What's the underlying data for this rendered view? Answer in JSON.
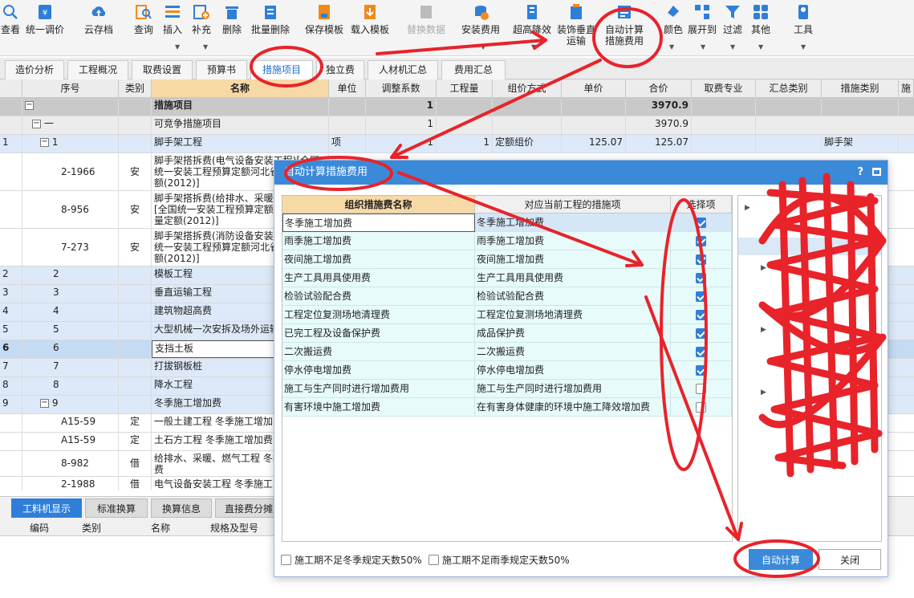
{
  "toolbar": {
    "items": [
      {
        "label": "查看",
        "icon": "view-icon"
      },
      {
        "label": "统一调价",
        "icon": "price-adjust-icon"
      },
      {
        "label": "云存档",
        "icon": "cloud-upload-icon"
      },
      {
        "label": "查询",
        "icon": "query-icon"
      },
      {
        "label": "插入",
        "icon": "insert-icon"
      },
      {
        "label": "补充",
        "icon": "supplement-icon"
      },
      {
        "label": "删除",
        "icon": "trash-icon"
      },
      {
        "label": "批量删除",
        "icon": "batch-delete-icon"
      },
      {
        "label": "保存模板",
        "icon": "save-template-icon"
      },
      {
        "label": "载入模板",
        "icon": "load-template-icon"
      },
      {
        "label": "替换数据",
        "icon": "replace-data-icon"
      },
      {
        "label": "安装费用",
        "icon": "install-fee-icon"
      },
      {
        "label": "超高降效",
        "icon": "height-reduce-icon"
      },
      {
        "label": "装饰垂直",
        "label2": "运输",
        "icon": "vertical-transport-icon"
      },
      {
        "label": "自动计算",
        "label2": "措施费用",
        "icon": "auto-calc-icon"
      },
      {
        "label": "颜色",
        "icon": "color-icon"
      },
      {
        "label": "展开到",
        "icon": "expand-icon"
      },
      {
        "label": "过滤",
        "icon": "filter-icon"
      },
      {
        "label": "其他",
        "icon": "other-icon"
      },
      {
        "label": "工具",
        "icon": "tool-icon"
      }
    ]
  },
  "tabs": [
    "造价分析",
    "工程概况",
    "取费设置",
    "预算书",
    "措施项目",
    "独立费",
    "人材机汇总",
    "费用汇总"
  ],
  "active_tab": "措施项目",
  "grid": {
    "headers": [
      "序号",
      "类别",
      "名称",
      "单位",
      "调整系数",
      "工程量",
      "组价方式",
      "单价",
      "合价",
      "取费专业",
      "汇总类别",
      "措施类别",
      "施"
    ],
    "rows": [
      {
        "idx": "",
        "seq": "措施项目",
        "cat": "",
        "name": "措施项目",
        "unit": "",
        "coef": "1",
        "qty": "",
        "method": "",
        "price": "",
        "total": "3970.9",
        "measure": ""
      },
      {
        "idx": "",
        "seq": "一",
        "cat": "",
        "name": "可竞争措施项目",
        "unit": "",
        "coef": "1",
        "qty": "",
        "method": "",
        "price": "",
        "total": "3970.9",
        "measure": ""
      },
      {
        "idx": "1",
        "seq": "1",
        "cat": "",
        "name": "脚手架工程",
        "unit": "项",
        "coef": "1",
        "qty": "1",
        "method": "定额组价",
        "price": "125.07",
        "total": "125.07",
        "measure": "脚手架"
      },
      {
        "idx": "",
        "seq": "2-1966",
        "cat": "安",
        "name": "脚手架搭拆费(电气设备安装工程)[全国统一安装工程预算定额河北省消耗量定额(2012)]",
        "unit": "",
        "coef": "",
        "qty": "",
        "method": "",
        "price": "",
        "total": "",
        "measure": ""
      },
      {
        "idx": "",
        "seq": "8-956",
        "cat": "安",
        "name": "脚手架搭拆费(给排水、采暖、燃气工程)[全国统一安装工程预算定额河北省消耗量定额(2012)]",
        "unit": "",
        "coef": "",
        "qty": "",
        "method": "",
        "price": "",
        "total": "",
        "measure": ""
      },
      {
        "idx": "",
        "seq": "7-273",
        "cat": "安",
        "name": "脚手架搭拆费(消防设备安装工程)[全国统一安装工程预算定额河北省消耗量定额(2012)]",
        "unit": "",
        "coef": "",
        "qty": "",
        "method": "",
        "price": "",
        "total": "",
        "measure": ""
      },
      {
        "idx": "2",
        "seq": "2",
        "cat": "",
        "name": "模板工程",
        "unit": "",
        "coef": "",
        "qty": "",
        "method": "",
        "price": "",
        "total": "",
        "measure": ""
      },
      {
        "idx": "3",
        "seq": "3",
        "cat": "",
        "name": "垂直运输工程",
        "unit": "",
        "coef": "",
        "qty": "",
        "method": "",
        "price": "",
        "total": "",
        "measure": ""
      },
      {
        "idx": "4",
        "seq": "4",
        "cat": "",
        "name": "建筑物超高费",
        "unit": "",
        "coef": "",
        "qty": "",
        "method": "",
        "price": "",
        "total": "",
        "measure": ""
      },
      {
        "idx": "5",
        "seq": "5",
        "cat": "",
        "name": "大型机械一次安拆及场外运输",
        "unit": "",
        "coef": "",
        "qty": "",
        "method": "",
        "price": "",
        "total": "",
        "measure": ""
      },
      {
        "idx": "6",
        "seq": "6",
        "cat": "",
        "name": "支挡土板",
        "unit": "",
        "coef": "",
        "qty": "",
        "method": "",
        "price": "",
        "total": "",
        "measure": ""
      },
      {
        "idx": "7",
        "seq": "7",
        "cat": "",
        "name": "打拔钢板桩",
        "unit": "",
        "coef": "",
        "qty": "",
        "method": "",
        "price": "",
        "total": "",
        "measure": ""
      },
      {
        "idx": "8",
        "seq": "8",
        "cat": "",
        "name": "降水工程",
        "unit": "",
        "coef": "",
        "qty": "",
        "method": "",
        "price": "",
        "total": "",
        "measure": ""
      },
      {
        "idx": "9",
        "seq": "9",
        "cat": "",
        "name": "冬季施工增加费",
        "unit": "",
        "coef": "",
        "qty": "",
        "method": "",
        "price": "",
        "total": "",
        "measure": ""
      },
      {
        "idx": "",
        "seq": "A15-59",
        "cat": "定",
        "name": "一般土建工程 冬季施工增加",
        "unit": "",
        "coef": "",
        "qty": "",
        "method": "",
        "price": "",
        "total": "",
        "measure": ""
      },
      {
        "idx": "",
        "seq": "A15-59",
        "cat": "定",
        "name": "土石方工程 冬季施工增加费",
        "unit": "",
        "coef": "",
        "qty": "",
        "method": "",
        "price": "",
        "total": "",
        "measure": ""
      },
      {
        "idx": "",
        "seq": "8-982",
        "cat": "借",
        "name": "给排水、采暖、燃气工程 冬季施工增加费",
        "unit": "",
        "coef": "",
        "qty": "",
        "method": "",
        "price": "",
        "total": "",
        "measure": ""
      },
      {
        "idx": "",
        "seq": "2-1988",
        "cat": "借",
        "name": "电气设备安装工程 冬季施工",
        "unit": "",
        "coef": "",
        "qty": "",
        "method": "",
        "price": "",
        "total": "",
        "measure": ""
      }
    ]
  },
  "bottom": {
    "tabs": [
      "工料机显示",
      "标准换算",
      "换算信息",
      "直接费分摊"
    ],
    "headers": [
      "编码",
      "类别",
      "名称",
      "规格及型号"
    ]
  },
  "dialog": {
    "title": "自动计算措施费用",
    "help": "?",
    "headers": [
      "组织措施费名称",
      "对应当前工程的措施项",
      "选择项"
    ],
    "rows": [
      {
        "name": "冬季施工增加费",
        "match": "冬季施工增加费",
        "checked": true
      },
      {
        "name": "雨季施工增加费",
        "match": "雨季施工增加费",
        "checked": true
      },
      {
        "name": "夜间施工增加费",
        "match": "夜间施工增加费",
        "checked": true
      },
      {
        "name": "生产工具用具使用费",
        "match": "生产工具用具使用费",
        "checked": true
      },
      {
        "name": "检验试验配合费",
        "match": "检验试验配合费",
        "checked": true
      },
      {
        "name": "工程定位复测场地清理费",
        "match": "工程定位复测场地清理费",
        "checked": true
      },
      {
        "name": "已完工程及设备保护费",
        "match": "成品保护费",
        "checked": true
      },
      {
        "name": "二次搬运费",
        "match": "二次搬运费",
        "checked": true
      },
      {
        "name": "停水停电增加费",
        "match": "停水停电增加费",
        "checked": true
      },
      {
        "name": "施工与生产同时进行增加费用",
        "match": "施工与生产同时进行增加费用",
        "checked": false
      },
      {
        "name": "有害环境中施工增加费",
        "match": "在有害身体健康的环境中施工降效增加费",
        "checked": false
      }
    ],
    "opt_winter": "施工期不足冬季规定天数50%",
    "opt_rain": "施工期不足雨季规定天数50%",
    "btn_auto": "自动计算",
    "btn_close": "关闭"
  },
  "annotation_color": "#e8232a"
}
